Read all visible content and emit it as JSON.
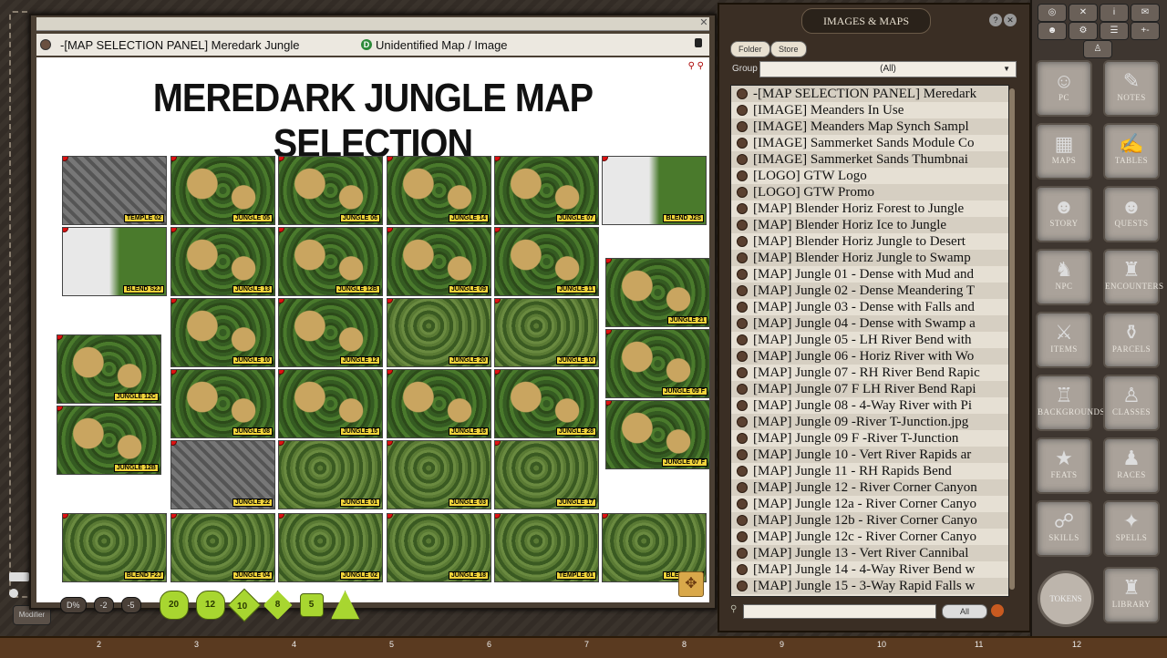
{
  "map_window": {
    "title": "-[MAP SELECTION PANEL] Meredark Jungle",
    "status": "Unidentified Map / Image",
    "status_badge": "D",
    "heading": "MEREDARK JUNGLE MAP SELECTION",
    "tiles": [
      {
        "label": "TEMPLE 02",
        "kind": "temple"
      },
      {
        "label": "JUNGLE 05",
        "kind": "jungle"
      },
      {
        "label": "JUNGLE 06",
        "kind": "jungle"
      },
      {
        "label": "JUNGLE 14",
        "kind": "jungle"
      },
      {
        "label": "JUNGLE 07",
        "kind": "jungle"
      },
      {
        "label": "BLEND J2S",
        "kind": "blend"
      },
      {
        "label": "BLEND S2J",
        "kind": "blend"
      },
      {
        "label": "JUNGLE 13",
        "kind": "jungle"
      },
      {
        "label": "JUNGLE 12B",
        "kind": "jungle"
      },
      {
        "label": "JUNGLE 09",
        "kind": "jungle"
      },
      {
        "label": "JUNGLE 11",
        "kind": "jungle"
      },
      {
        "label": "JUNGLE 21",
        "kind": "jungle"
      },
      {
        "label": "JUNGLE 10",
        "kind": "jungle"
      },
      {
        "label": "JUNGLE 12",
        "kind": "jungle"
      },
      {
        "label": "JUNGLE 20",
        "kind": "dense"
      },
      {
        "label": "JUNGLE 10",
        "kind": "dense"
      },
      {
        "label": "JUNGLE 12C",
        "kind": "jungle"
      },
      {
        "label": "JUNGLE 09 F",
        "kind": "jungle"
      },
      {
        "label": "JUNGLE 12B",
        "kind": "jungle"
      },
      {
        "label": "JUNGLE 08",
        "kind": "jungle"
      },
      {
        "label": "JUNGLE 15",
        "kind": "jungle"
      },
      {
        "label": "JUNGLE 16",
        "kind": "jungle"
      },
      {
        "label": "JUNGLE 28",
        "kind": "jungle"
      },
      {
        "label": "JUNGLE 07 F",
        "kind": "jungle"
      },
      {
        "label": "JUNGLE 22",
        "kind": "temple"
      },
      {
        "label": "JUNGLE 01",
        "kind": "dense"
      },
      {
        "label": "JUNGLE 03",
        "kind": "dense"
      },
      {
        "label": "JUNGLE 17",
        "kind": "dense"
      },
      {
        "label": "BLEND F2J",
        "kind": "dense"
      },
      {
        "label": "JUNGLE 04",
        "kind": "dense"
      },
      {
        "label": "JUNGLE 02",
        "kind": "dense"
      },
      {
        "label": "JUNGLE 18",
        "kind": "dense"
      },
      {
        "label": "TEMPLE 01",
        "kind": "dense"
      },
      {
        "label": "BLEND J2S",
        "kind": "dense"
      }
    ]
  },
  "dice_bar": {
    "mod_label": "Modifier",
    "buttons": [
      "D%",
      "-2",
      "-5"
    ],
    "dice": [
      {
        "name": "d20",
        "face": "20"
      },
      {
        "name": "d12",
        "face": "12"
      },
      {
        "name": "d10",
        "face": "10"
      },
      {
        "name": "d8",
        "face": "8"
      },
      {
        "name": "d6",
        "face": "5"
      },
      {
        "name": "d4",
        "face": ""
      }
    ]
  },
  "images_maps": {
    "title": "IMAGES & MAPS",
    "folder_label": "Folder",
    "store_label": "Store",
    "group_label": "Group",
    "group_value": "(All)",
    "all_label": "All",
    "items": [
      "-[MAP SELECTION PANEL] Meredark",
      "[IMAGE] Meanders In Use",
      "[IMAGE] Meanders Map Synch Sampl",
      "[IMAGE] Sammerket Sands Module Co",
      "[IMAGE] Sammerket Sands Thumbnai",
      "[LOGO] GTW Logo",
      "[LOGO] GTW Promo",
      "[MAP] Blender Horiz Forest to Jungle",
      "[MAP] Blender Horiz Ice to Jungle",
      "[MAP] Blender Horiz Jungle to Desert",
      "[MAP] Blender Horiz Jungle to Swamp",
      "[MAP] Jungle 01 - Dense with Mud and",
      "[MAP] Jungle 02 - Dense Meandering T",
      "[MAP] Jungle 03 - Dense with Falls and",
      "[MAP] Jungle 04 - Dense with Swamp a",
      "[MAP] Jungle 05 - LH River Bend with",
      "[MAP] Jungle 06 - Horiz River with Wo",
      "[MAP] Jungle 07 - RH River Bend Rapic",
      "[MAP] Jungle 07 F LH River Bend Rapi",
      "[MAP] Jungle 08 - 4-Way River with Pi",
      "[MAP] Jungle 09 -River T-Junction.jpg",
      "[MAP] Jungle 09 F -River T-Junction",
      "[MAP] Jungle 10 - Vert River Rapids ar",
      "[MAP] Jungle 11 - RH Rapids Bend",
      "[MAP] Jungle 12 - River Corner Canyon",
      "[MAP] Jungle 12a - River Corner Canyo",
      "[MAP] Jungle 12b - River Corner Canyo",
      "[MAP] Jungle 12c - River Corner Canyo",
      "[MAP] Jungle 13 - Vert River Cannibal",
      "[MAP] Jungle 14 - 4-Way River Bend w",
      "[MAP] Jungle 15 - 3-Way Rapid Falls w"
    ]
  },
  "sidebar": {
    "buttons": [
      {
        "label": "PC",
        "glyph": "☺"
      },
      {
        "label": "NOTES",
        "glyph": "✎"
      },
      {
        "label": "MAPS",
        "glyph": "▦"
      },
      {
        "label": "TABLES",
        "glyph": "✍"
      },
      {
        "label": "STORY",
        "glyph": "☻"
      },
      {
        "label": "QUESTS",
        "glyph": "☻"
      },
      {
        "label": "NPC",
        "glyph": "♞"
      },
      {
        "label": "ENCOUNTERS",
        "glyph": "♜"
      },
      {
        "label": "ITEMS",
        "glyph": "⚔"
      },
      {
        "label": "PARCELS",
        "glyph": "⚱"
      },
      {
        "label": "BACKGROUNDS",
        "glyph": "♖"
      },
      {
        "label": "CLASSES",
        "glyph": "♙"
      },
      {
        "label": "FEATS",
        "glyph": "★"
      },
      {
        "label": "RACES",
        "glyph": "♟"
      },
      {
        "label": "SKILLS",
        "glyph": "☍"
      },
      {
        "label": "SPELLS",
        "glyph": "✦"
      },
      {
        "label": "LIBRARY",
        "glyph": "♜"
      }
    ],
    "tokens_label": "TOKENS",
    "top_icons": [
      "◎",
      "✕",
      "i",
      "✉",
      "☻",
      "⚙",
      "☰",
      "+-",
      "♙"
    ]
  },
  "ruler": [
    "2",
    "3",
    "4",
    "5",
    "6",
    "7",
    "8",
    "9",
    "10",
    "11",
    "12"
  ]
}
